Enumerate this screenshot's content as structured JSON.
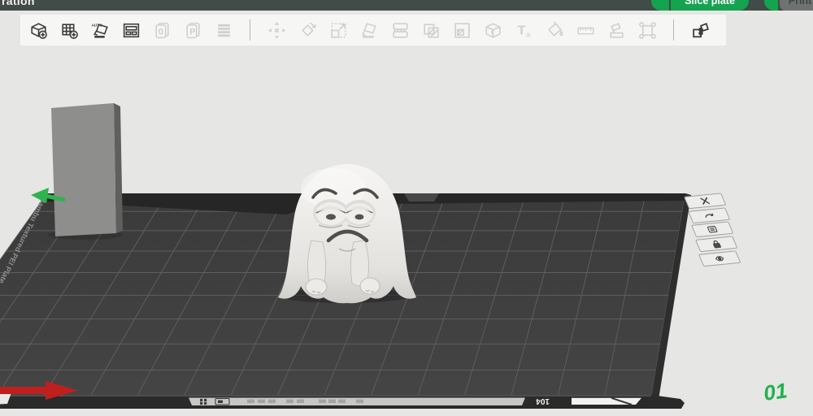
{
  "header": {
    "title_fragment": "ration",
    "slice_button": {
      "label": "Slice plate",
      "color": "#15a350"
    },
    "print_button": {
      "label": "Print",
      "color": "#6f7270"
    },
    "bar_color": "#414b47"
  },
  "toolbar": {
    "items": [
      {
        "name": "add-model",
        "icon": "cubeplus",
        "enabled": true
      },
      {
        "name": "add-plate",
        "icon": "gridplus",
        "enabled": true
      },
      {
        "name": "auto-orient",
        "icon": "autoorient",
        "enabled": true
      },
      {
        "name": "arrange",
        "icon": "arrange",
        "enabled": true
      },
      {
        "name": "doc-0",
        "icon": "doc0",
        "enabled": false
      },
      {
        "name": "doc-p",
        "icon": "docp",
        "enabled": false
      },
      {
        "name": "object-list",
        "icon": "rows",
        "enabled": false
      },
      {
        "sep": true
      },
      {
        "name": "move",
        "icon": "move",
        "enabled": false
      },
      {
        "name": "rotate",
        "icon": "rotate",
        "enabled": false
      },
      {
        "name": "scale",
        "icon": "scale",
        "enabled": false
      },
      {
        "name": "lay-flat",
        "icon": "layflat",
        "enabled": false
      },
      {
        "name": "split",
        "icon": "splith",
        "enabled": false
      },
      {
        "name": "variable-layer",
        "icon": "varlayer",
        "enabled": false
      },
      {
        "name": "fill",
        "icon": "fillcorner",
        "enabled": false
      },
      {
        "name": "mesh-edit",
        "icon": "meshcube",
        "enabled": false
      },
      {
        "name": "add-text",
        "icon": "texttool",
        "enabled": false
      },
      {
        "name": "paint",
        "icon": "paint",
        "enabled": false
      },
      {
        "name": "measure",
        "icon": "measure",
        "enabled": false
      },
      {
        "name": "split-objects",
        "icon": "splitobj",
        "enabled": false
      },
      {
        "name": "assemble",
        "icon": "frame",
        "enabled": false
      },
      {
        "sep": true
      },
      {
        "name": "assembly-view",
        "icon": "puzzle",
        "enabled": true
      }
    ]
  },
  "viewport": {
    "plate": {
      "name": "Bambu Textured PEI Plate",
      "number": "01",
      "number_color": "#1fb14d",
      "edge_code": "104"
    },
    "plate_buttons": [
      {
        "name": "delete-plate",
        "icon": "pb-x"
      },
      {
        "name": "swap-plate",
        "icon": "pb-swap"
      },
      {
        "name": "plate-settings",
        "icon": "pb-settings"
      },
      {
        "name": "lock-plate",
        "icon": "pb-lock"
      },
      {
        "name": "focus-plate",
        "icon": "pb-focus"
      }
    ],
    "axes": {
      "x_color": "#c01f1f",
      "y_color": "#2fb350"
    },
    "model": {
      "name": "sad-ghost"
    }
  }
}
